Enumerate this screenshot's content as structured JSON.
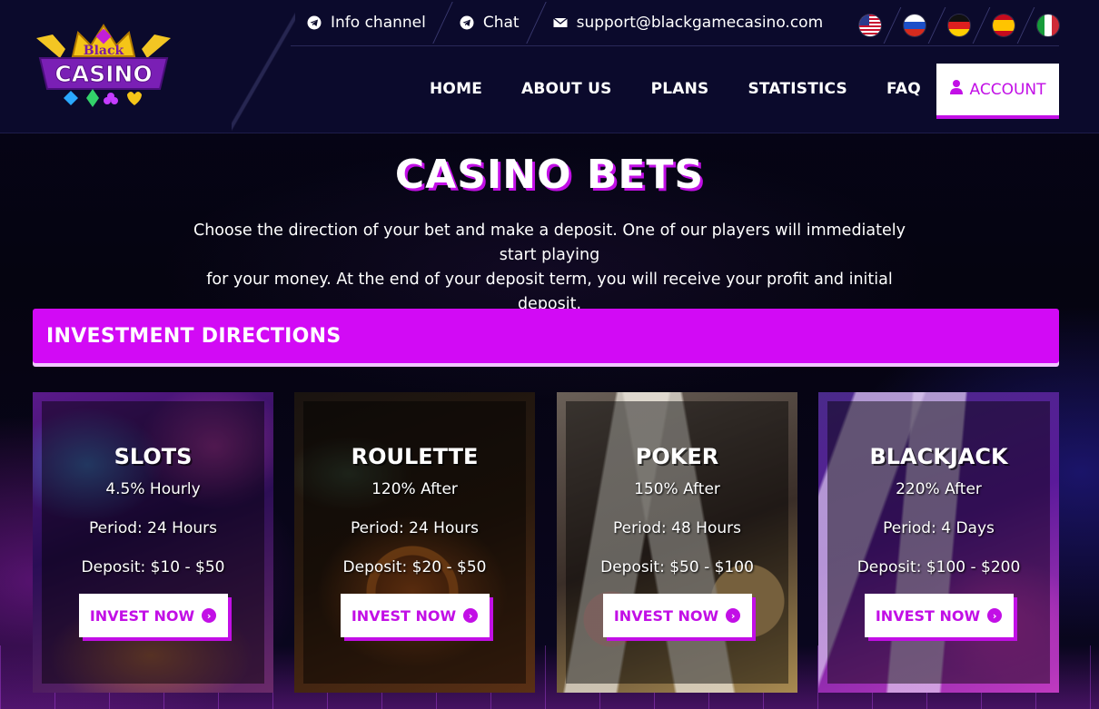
{
  "brand": {
    "logo_top": "Black",
    "logo_main": "CASINO"
  },
  "topbar": {
    "info_channel": "Info channel",
    "chat": "Chat",
    "email": "support@blackgamecasino.com"
  },
  "languages": [
    {
      "icon": "flag-us-icon"
    },
    {
      "icon": "flag-ru-icon"
    },
    {
      "icon": "flag-de-icon"
    },
    {
      "icon": "flag-es-icon"
    },
    {
      "icon": "flag-it-icon"
    }
  ],
  "nav": {
    "items": [
      "HOME",
      "ABOUT US",
      "PLANS",
      "STATISTICS",
      "FAQ"
    ],
    "account": "ACCOUNT"
  },
  "hero": {
    "title": "CASINO BETS",
    "intro_line1": "Choose the direction of your bet and make a deposit. One of our players will immediately start playing",
    "intro_line2": "for your money. At the end of your deposit term, you will receive your profit and initial deposit."
  },
  "section": {
    "title": "INVESTMENT DIRECTIONS"
  },
  "plans": [
    {
      "name": "SLOTS",
      "rate": "4.5% Hourly",
      "period": "Period: 24 Hours",
      "deposit": "Deposit: $10 - $50",
      "button": "INVEST NOW"
    },
    {
      "name": "ROULETTE",
      "rate": "120% After",
      "period": "Period: 24 Hours",
      "deposit": "Deposit: $20 - $50",
      "button": "INVEST NOW"
    },
    {
      "name": "POKER",
      "rate": "150% After",
      "period": "Period: 48 Hours",
      "deposit": "Deposit: $50 - $100",
      "button": "INVEST NOW"
    },
    {
      "name": "BLACKJACK",
      "rate": "220% After",
      "period": "Period: 4 Days",
      "deposit": "Deposit: $100 - $200",
      "button": "INVEST NOW"
    }
  ],
  "colors": {
    "accent": "#c20fe6",
    "section_bar": "#d20af5",
    "header_bg": "#0b0a2c"
  }
}
